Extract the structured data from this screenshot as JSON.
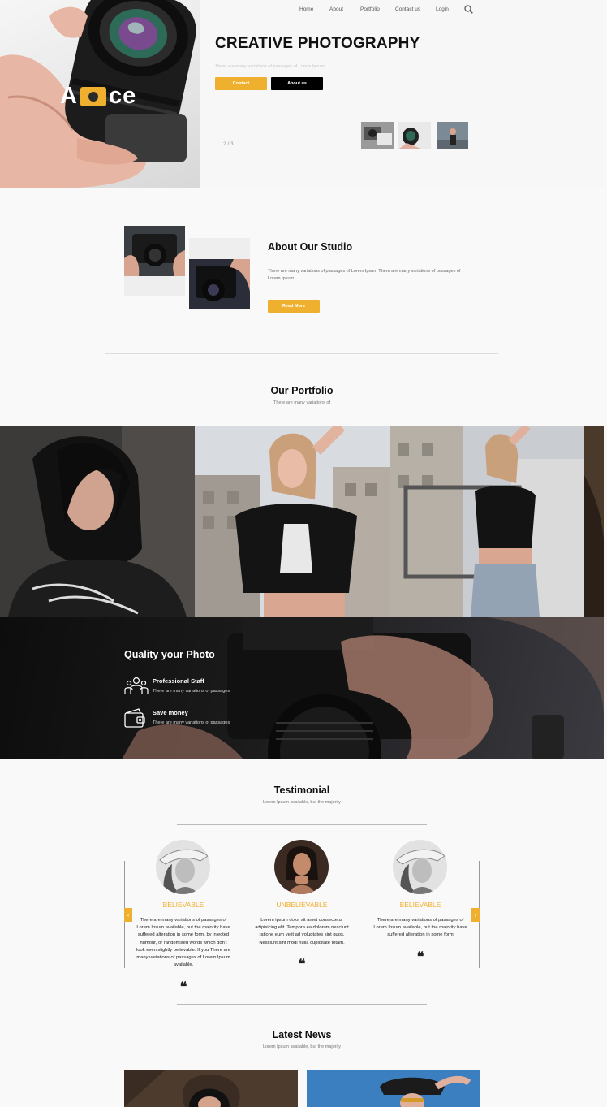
{
  "brand": {
    "logo_text_left": "A",
    "logo_text_right": "ce"
  },
  "nav": {
    "items": [
      "Home",
      "About",
      "Portfolio",
      "Contact us",
      "Login"
    ],
    "search_icon": "search-icon"
  },
  "hero": {
    "title": "CREATIVE PHOTOGRAPHY",
    "subtitle": "There are many variations of passages of Lorem Ipsum",
    "contact_label": "Contact",
    "about_label": "About us",
    "slide_counter": "2 / 3"
  },
  "about": {
    "title": "About Our Studio",
    "text": "There are many variations of passages of Lorem Ipsum There are many variations of passages of Lorem Ipsum",
    "read_more_label": "Read More"
  },
  "portfolio": {
    "title": "Our Portfolio",
    "subtitle": "There are many variations of"
  },
  "quality": {
    "title": "Quality your Photo",
    "items": [
      {
        "icon": "team-icon",
        "title": "Professional Staff",
        "text": "There are many variations of passages"
      },
      {
        "icon": "wallet-icon",
        "title": "Save money",
        "text": "There are many variations of passages"
      }
    ]
  },
  "testimonial": {
    "title": "Testimonial",
    "subtitle": "Lorem Ipsum available, but the majority",
    "prev_icon": "chevron-left-icon",
    "next_icon": "chevron-right-icon",
    "items": [
      {
        "name": "BELIEVABLE",
        "text": "There are many variations of passages of Lorem Ipsum available, but the majority have suffered alteration in some form, by injected humour, or randomised words which don't look even slightly believable. If you There are many variations of passages of Lorem Ipsum available.",
        "quote": "❝"
      },
      {
        "name": "UNBELIEVABLE",
        "text": "Lorem ipsum dolor sit amet consectetur adipisicing elit. Tempora ea dolorum nesciunt ratione eum velit ad voluptates sint quos. Nesciunt sint modi nulla cupiditate totam.",
        "quote": "❝"
      },
      {
        "name": "BELIEVABLE",
        "text": "There are many variations of passages of Lorem Ipsum available, but the majority have suffered alteration in some form",
        "quote": "❝"
      }
    ]
  },
  "news": {
    "title": "Latest News",
    "subtitle": "Lorem Ipsum available, but the majority"
  },
  "colors": {
    "accent": "#f0b02f",
    "dark": "#000000",
    "background": "#f9f9f9"
  }
}
